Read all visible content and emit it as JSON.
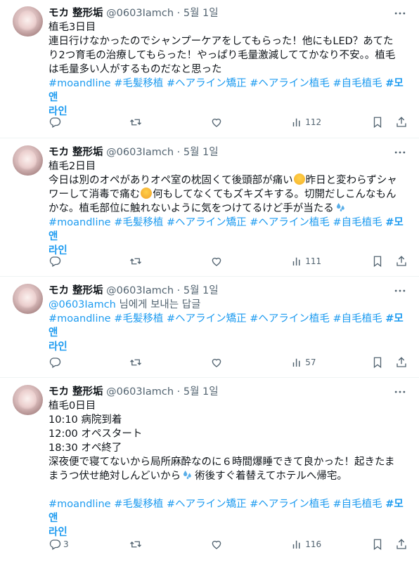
{
  "colors": {
    "accent": "#1d9bf0",
    "muted": "#536471",
    "text": "#0f1419",
    "divider": "#eff3f4"
  },
  "icons": {
    "more": "more-dots-icon",
    "reply": "reply-icon",
    "retweet": "retweet-icon",
    "like": "like-icon",
    "views": "views-icon",
    "bookmark": "bookmark-icon",
    "share": "share-icon"
  },
  "tweets": [
    {
      "name": "モカ 整形垢",
      "handle": "@0603Iamch",
      "time": "5월 1일",
      "lines": [
        "植毛3日目",
        "連日行けなかったのでシャンプーケアをしてもらった！他にもLED？あてた",
        "り2つ育毛の治療してもらった！やっぱり毛量激減しててかなり不安。。植毛",
        "は毛量多い人がするものだなと思った"
      ],
      "tags": [
        "#moandline",
        "#毛髪移植",
        "#ヘアライン矯正",
        "#ヘアライン植毛",
        "#自毛植毛"
      ],
      "bold_tag_1": "#모앤",
      "bold_tag_2": "라인",
      "replies": "",
      "views": "112"
    },
    {
      "name": "モカ 整形垢",
      "handle": "@0603Iamch",
      "time": "5월 1일",
      "line1": "植毛2日目",
      "line2a": "今日は別のオペがありオペ室の枕固くて後頭部が痛い",
      "line2b": "昨日と変わらずシャ",
      "line3a": "ワーして消毒で痛む",
      "line3b": "何もしてなくてもズキズキする。切開だしこんなもん",
      "line4": "かな。植毛部位に触れないように気をつけてるけど手が当たる",
      "tags": [
        "#moandline",
        "#毛髪移植",
        "#ヘアライン矯正",
        "#ヘアライン植毛",
        "#自毛植毛"
      ],
      "bold_tag_1": "#모앤",
      "bold_tag_2": "라인",
      "replies": "",
      "views": "111"
    },
    {
      "name": "モカ 整形垢",
      "handle": "@0603Iamch",
      "time": "5월 1일",
      "mention": "@0603Iamch",
      "mention_suffix": " 님에게 보내는 답글",
      "tags": [
        "#moandline",
        "#毛髪移植",
        "#ヘアライン矯正",
        "#ヘアライン植毛",
        "#自毛植毛"
      ],
      "bold_tag_1": "#모앤",
      "bold_tag_2": "라인",
      "replies": "",
      "views": "57"
    },
    {
      "name": "モカ 整形垢",
      "handle": "@0603Iamch",
      "time": "5월 1일",
      "lines": [
        "植毛0日目",
        "10:10 病院到着",
        "12:00 オペスタート",
        "18:30 オペ終了",
        "深夜便で寝てないから局所麻酔なのに６時間爆睡できて良かった！起きたま"
      ],
      "line6a": "まうつ伏せ絶対しんどいから",
      "line6b": "術後すぐ着替えてホテルへ帰宅。",
      "tags": [
        "#moandline",
        "#毛髪移植",
        "#ヘアライン矯正",
        "#ヘアライン植毛",
        "#自毛植毛"
      ],
      "bold_tag_1": "#모앤",
      "bold_tag_2": "라인",
      "replies": "3",
      "views": "116"
    }
  ]
}
